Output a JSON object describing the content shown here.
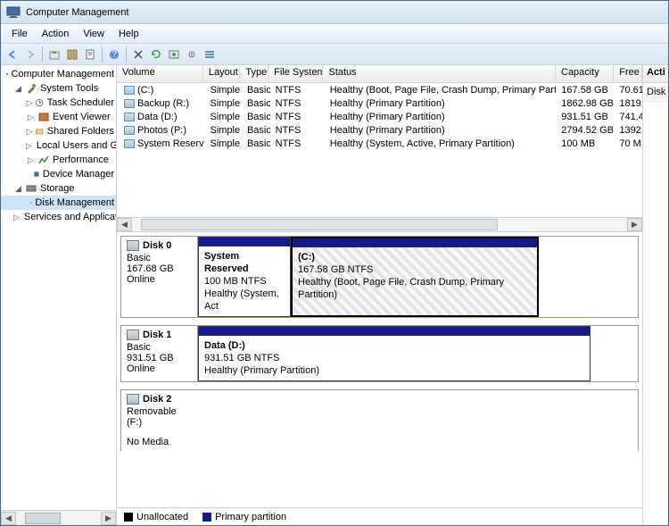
{
  "window": {
    "title": "Computer Management"
  },
  "menu": {
    "file": "File",
    "action": "Action",
    "view": "View",
    "help": "Help"
  },
  "tree": {
    "root": "Computer Management",
    "systools": "System Tools",
    "tasksched": "Task Scheduler",
    "eventviewer": "Event Viewer",
    "sharedfolders": "Shared Folders",
    "localusers": "Local Users and Groups",
    "performance": "Performance",
    "devicemgr": "Device Manager",
    "storage": "Storage",
    "diskmgmt": "Disk Management",
    "services": "Services and Applications"
  },
  "cols": {
    "volume": "Volume",
    "layout": "Layout",
    "type": "Type",
    "fs": "File System",
    "status": "Status",
    "capacity": "Capacity",
    "free": "Free :"
  },
  "vols": [
    {
      "name": "(C:)",
      "layout": "Simple",
      "type": "Basic",
      "fs": "NTFS",
      "status": "Healthy (Boot, Page File, Crash Dump, Primary Partition)",
      "cap": "167.58 GB",
      "free": "70.61"
    },
    {
      "name": "Backup (R:)",
      "layout": "Simple",
      "type": "Basic",
      "fs": "NTFS",
      "status": "Healthy (Primary Partition)",
      "cap": "1862.98 GB",
      "free": "1819."
    },
    {
      "name": "Data (D:)",
      "layout": "Simple",
      "type": "Basic",
      "fs": "NTFS",
      "status": "Healthy (Primary Partition)",
      "cap": "931.51 GB",
      "free": "741.4"
    },
    {
      "name": "Photos (P:)",
      "layout": "Simple",
      "type": "Basic",
      "fs": "NTFS",
      "status": "Healthy (Primary Partition)",
      "cap": "2794.52 GB",
      "free": "1392."
    },
    {
      "name": "System Reserved",
      "layout": "Simple",
      "type": "Basic",
      "fs": "NTFS",
      "status": "Healthy (System, Active, Primary Partition)",
      "cap": "100 MB",
      "free": "70 M"
    }
  ],
  "disks": {
    "d0": {
      "name": "Disk 0",
      "type": "Basic",
      "size": "167.68 GB",
      "state": "Online"
    },
    "d0p0": {
      "title": "System Reserved",
      "detail": "100 MB NTFS",
      "status": "Healthy (System, Act"
    },
    "d0p1": {
      "title": "(C:)",
      "detail": "167.58 GB NTFS",
      "status": "Healthy (Boot, Page File, Crash Dump, Primary Partition)"
    },
    "d1": {
      "name": "Disk 1",
      "type": "Basic",
      "size": "931.51 GB",
      "state": "Online"
    },
    "d1p0": {
      "title": "Data  (D:)",
      "detail": "931.51 GB NTFS",
      "status": "Healthy (Primary Partition)"
    },
    "d2": {
      "name": "Disk 2",
      "type": "Removable (F:)",
      "state": "No Media"
    }
  },
  "legend": {
    "unalloc": "Unallocated",
    "primary": "Primary partition"
  },
  "actions": {
    "header": "Acti",
    "disk": "Disk"
  }
}
